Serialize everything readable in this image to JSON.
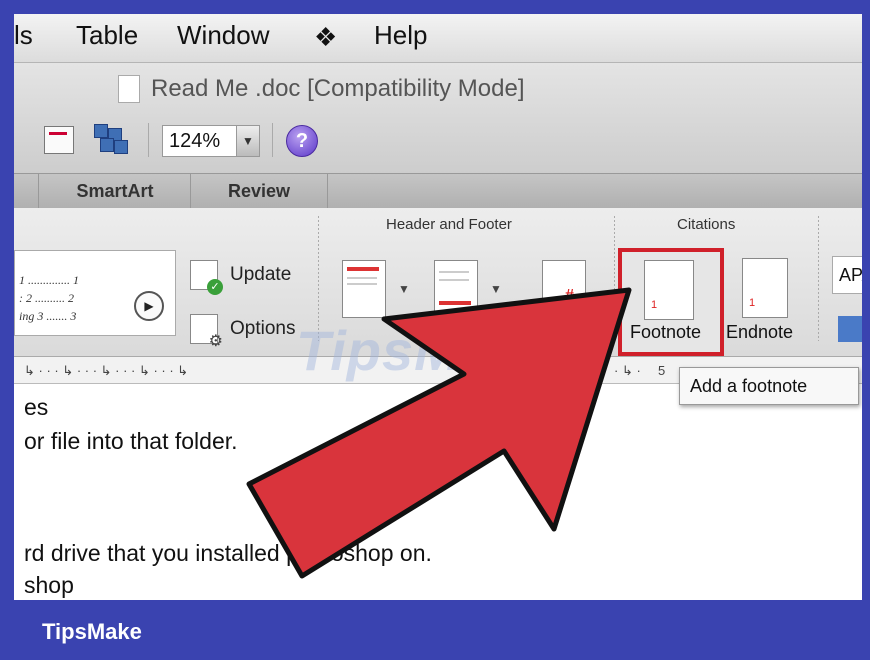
{
  "menu": {
    "tools_partial": "ls",
    "table": "Table",
    "window": "Window",
    "help": "Help"
  },
  "window": {
    "title": "Read Me .doc [Compatibility Mode]",
    "zoom": "124%"
  },
  "ribbon_tabs": [
    "SmartArt",
    "Review"
  ],
  "ribbon": {
    "toc_lines": [
      "1 .............. 1",
      ": 2 .......... 2",
      "ing 3 ....... 3"
    ],
    "update_label": "Update",
    "options_label": "Options",
    "header_footer_group": "Header and Footer",
    "citations_group": "Citations",
    "footnote_label": "Footnote",
    "endnote_label": "Endnote",
    "footnote_num": "1",
    "endnote_num": "1",
    "style_box": "APA"
  },
  "ruler": {
    "marker": "5"
  },
  "tooltip": "Add a footnote",
  "document": {
    "lines": [
      "es",
      "or file into that folder.",
      "rd drive that you installed photoshop on.",
      "shop"
    ]
  },
  "watermark": "TipsMake",
  "footer_brand": "TipsMake",
  "colors": {
    "frame": "#3a43b0",
    "highlight": "#d0202a",
    "arrow": "#d9343c"
  }
}
